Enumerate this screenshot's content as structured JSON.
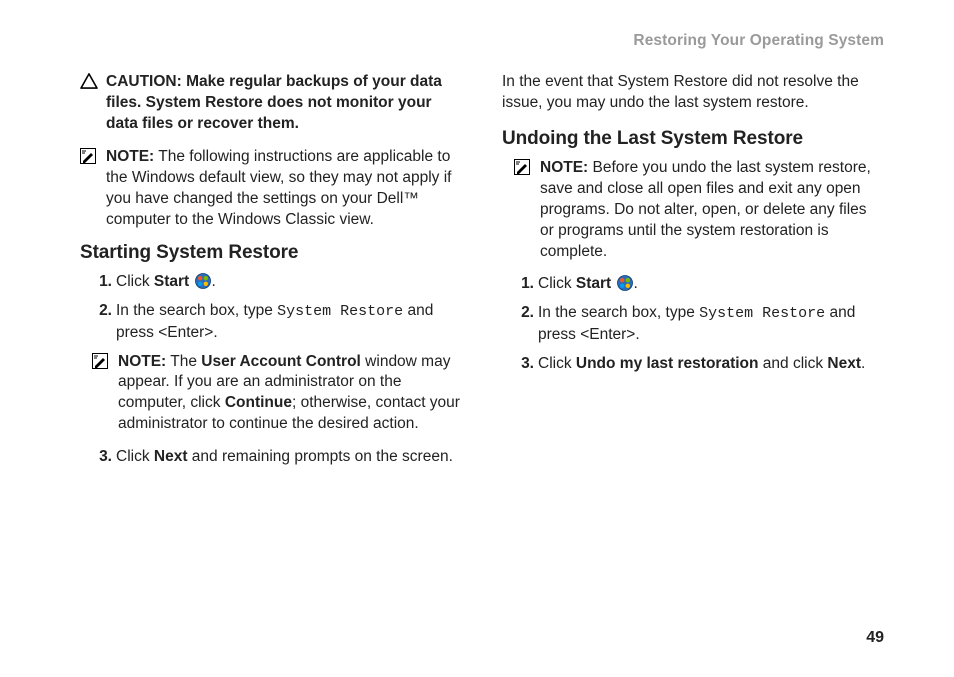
{
  "header": "Restoring Your Operating System",
  "left": {
    "caution_label": "CAUTION:",
    "caution_text": " Make regular backups of your data files. System Restore does not monitor your data files or recover them.",
    "note1_label": "NOTE:",
    "note1_text": " The following instructions are applicable to the Windows default view, so they may not apply if you have changed the settings on your Dell™ computer to the Windows Classic view.",
    "h1": "Starting System Restore",
    "s1_num": "1.",
    "s1_a": "Click ",
    "s1_b": "Start",
    "s1_c": " ",
    "s1_d": ".",
    "s2_num": "2.",
    "s2_a": "In the search box, type ",
    "s2_code": "System Restore",
    "s2_b": " and press <Enter>.",
    "note2_label": "NOTE:",
    "note2_a": " The ",
    "note2_b": "User Account Control",
    "note2_c": " window may appear. If you are an administrator on the computer, click ",
    "note2_d": "Continue",
    "note2_e": "; otherwise, contact your administrator to continue the desired action.",
    "s3_num": "3.",
    "s3_a": "Click ",
    "s3_b": "Next",
    "s3_c": " and remaining prompts on the screen."
  },
  "right": {
    "intro": "In the event that System Restore did not resolve the issue, you may undo the last system restore.",
    "h1": "Undoing the Last System Restore",
    "note_label": "NOTE:",
    "note_text": " Before you undo the last system restore, save and close all open files and exit any open programs. Do not alter, open, or delete any files or programs until the system restoration is complete.",
    "s1_num": "1.",
    "s1_a": "Click ",
    "s1_b": "Start",
    "s1_c": " ",
    "s1_d": ".",
    "s2_num": "2.",
    "s2_a": "In the search box, type ",
    "s2_code": "System Restore",
    "s2_b": " and press <Enter>.",
    "s3_num": "3.",
    "s3_a": "Click ",
    "s3_b": "Undo my last restoration",
    "s3_c": " and click ",
    "s3_d": "Next",
    "s3_e": "."
  },
  "page_number": "49"
}
